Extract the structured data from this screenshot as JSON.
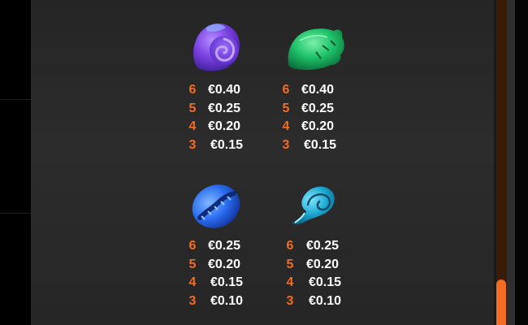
{
  "paytable": {
    "symbols": [
      {
        "name": "Purple snail shell",
        "icon": "purple-snail-shell-icon",
        "rows": [
          {
            "count": "6",
            "value": "€0.40"
          },
          {
            "count": "5",
            "value": "€0.25"
          },
          {
            "count": "4",
            "value": "€0.20"
          },
          {
            "count": "3",
            "value": "€0.15"
          }
        ]
      },
      {
        "name": "Green conch shell",
        "icon": "green-conch-shell-icon",
        "rows": [
          {
            "count": "6",
            "value": "€0.40"
          },
          {
            "count": "5",
            "value": "€0.25"
          },
          {
            "count": "4",
            "value": "€0.20"
          },
          {
            "count": "3",
            "value": "€0.15"
          }
        ]
      },
      {
        "name": "Blue cowrie shell",
        "icon": "blue-cowrie-shell-icon",
        "rows": [
          {
            "count": "6",
            "value": "€0.25"
          },
          {
            "count": "5",
            "value": "€0.20"
          },
          {
            "count": "4",
            "value": "€0.15"
          },
          {
            "count": "3",
            "value": "€0.10"
          }
        ]
      },
      {
        "name": "Teal spiral shell",
        "icon": "teal-spiral-shell-icon",
        "rows": [
          {
            "count": "6",
            "value": "€0.25"
          },
          {
            "count": "5",
            "value": "€0.20"
          },
          {
            "count": "4",
            "value": "€0.15"
          },
          {
            "count": "3",
            "value": "€0.10"
          }
        ]
      }
    ]
  },
  "colors": {
    "accent": "#f26d21",
    "text": "#ffffff",
    "panel": "#2a2a2a",
    "scrollbar_track": "#3a1c06"
  },
  "scrollbar": {
    "position_fraction": 1.0
  }
}
